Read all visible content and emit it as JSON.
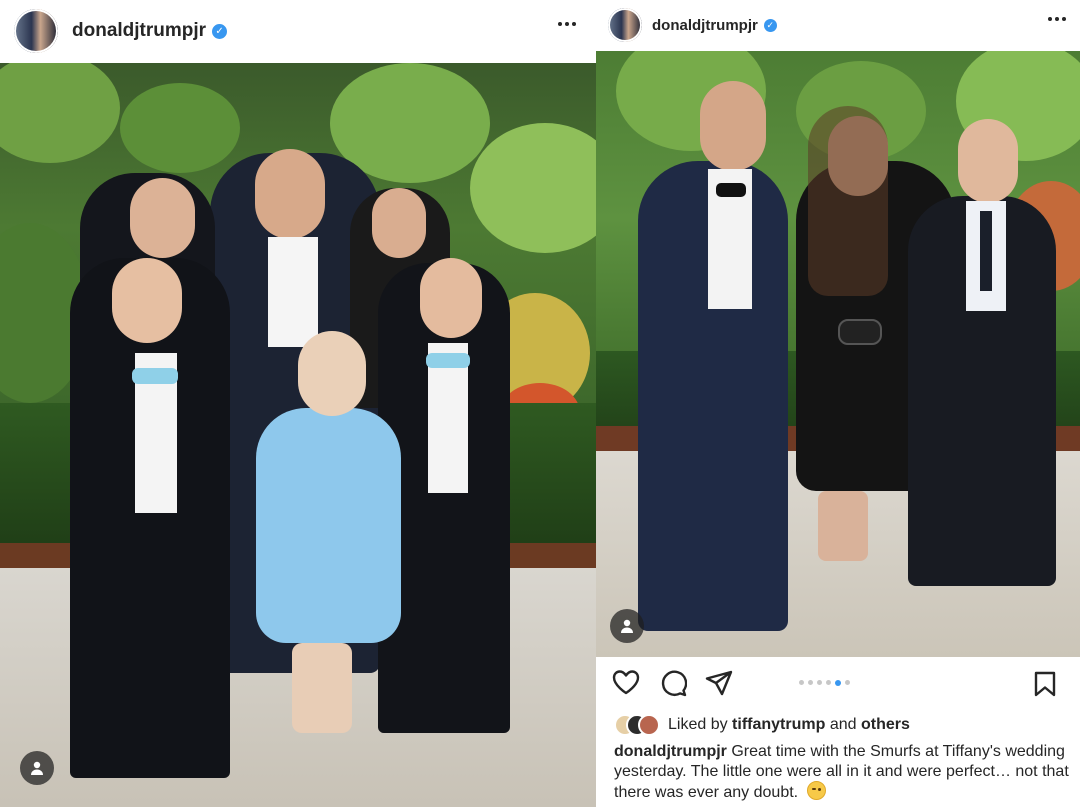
{
  "left_post": {
    "header": {
      "username": "donaldjtrumpjr",
      "verified_icon": "verified-badge-icon",
      "more_icon": "more-options-icon"
    },
    "photo": {
      "tag_icon": "user-tag-icon"
    }
  },
  "right_post": {
    "header": {
      "username": "donaldjtrumpjr",
      "verified_icon": "verified-badge-icon",
      "more_icon": "more-options-icon"
    },
    "photo": {
      "tag_icon": "user-tag-icon"
    },
    "actions": {
      "like_icon": "heart-icon",
      "comment_icon": "comment-bubble-icon",
      "share_icon": "paper-plane-icon",
      "save_icon": "bookmark-icon",
      "carousel_count": 6,
      "carousel_active_index": 4
    },
    "likes": {
      "prefix": "Liked by",
      "user": "tiffanytrump",
      "conjunction": "and",
      "others": "others"
    },
    "caption": {
      "username": "donaldjtrumpjr",
      "text": "Great time with the Smurfs at Tiffany's wedding yesterday. The little one were all in it  and were perfect… not that there was ever any doubt.",
      "emoji_icon": "winking-face-icon"
    }
  },
  "colors": {
    "verified": "#3897f0",
    "carousel_active": "#3897f0",
    "text": "#262626"
  }
}
